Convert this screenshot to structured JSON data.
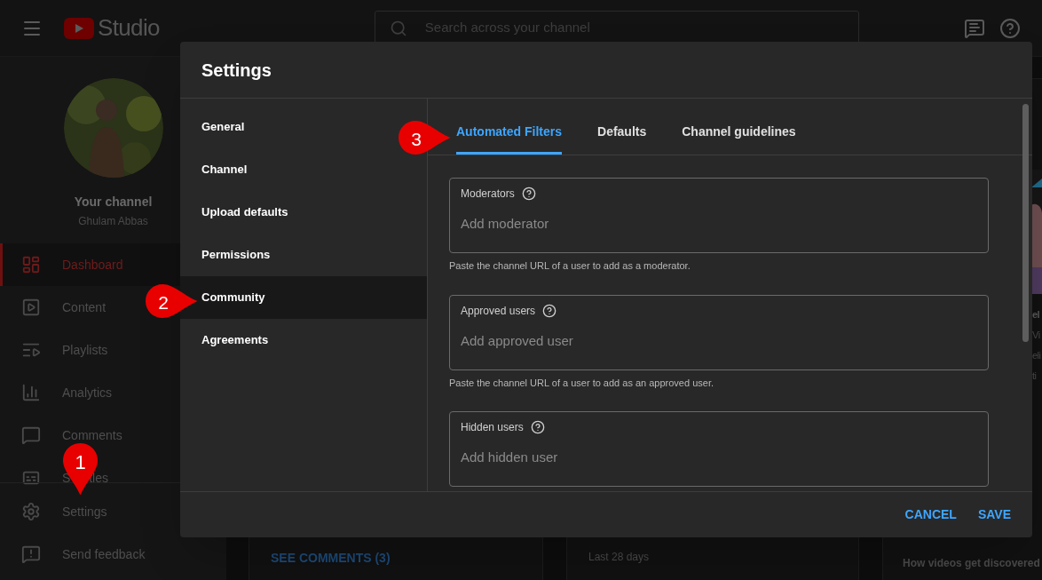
{
  "app": {
    "logo_text": "Studio",
    "search": {
      "placeholder": "Search across your channel"
    }
  },
  "sidebar": {
    "channel_label": "Your channel",
    "channel_name": "Ghulam Abbas",
    "items": [
      {
        "label": "Dashboard",
        "kind": "dashboard",
        "selected": true
      },
      {
        "label": "Content",
        "kind": "content",
        "selected": false
      },
      {
        "label": "Playlists",
        "kind": "playlists",
        "selected": false
      },
      {
        "label": "Analytics",
        "kind": "analytics",
        "selected": false
      },
      {
        "label": "Comments",
        "kind": "comments",
        "selected": false
      },
      {
        "label": "S",
        "label_end": "tles",
        "kind": "subtitles",
        "selected": false
      }
    ],
    "footer_items": [
      {
        "label": "Settings",
        "kind": "settings"
      },
      {
        "label": "Send feedback",
        "kind": "feedback"
      }
    ]
  },
  "background_cards": {
    "comments_link": "SEE COMMENTS (3)",
    "summary": {
      "subtitle": "Last 28 days"
    },
    "right_card": {
      "fragments": [
        "el",
        "Vi",
        "eli",
        "ti"
      ],
      "heading": "How videos get discovered"
    }
  },
  "dialog": {
    "title": "Settings",
    "nav": [
      {
        "label": "General",
        "selected": false
      },
      {
        "label": "Channel",
        "selected": false
      },
      {
        "label": "Upload defaults",
        "selected": false
      },
      {
        "label": "Permissions",
        "selected": false
      },
      {
        "label": "Community",
        "selected": true
      },
      {
        "label": "Agreements",
        "selected": false
      }
    ],
    "tabs": [
      {
        "label": "Automated Filters",
        "selected": true
      },
      {
        "label": "Defaults",
        "selected": false
      },
      {
        "label": "Channel guidelines",
        "selected": false
      }
    ],
    "fields": [
      {
        "label": "Moderators",
        "placeholder": "Add moderator",
        "hint": "Paste the channel URL of a user to add as a moderator."
      },
      {
        "label": "Approved users",
        "placeholder": "Add approved user",
        "hint": "Paste the channel URL of a user to add as an approved user."
      },
      {
        "label": "Hidden users",
        "placeholder": "Add hidden user"
      }
    ],
    "buttons": [
      "CANCEL",
      "SAVE"
    ]
  },
  "annotations": [
    {
      "number": "1"
    },
    {
      "number": "2"
    },
    {
      "number": "3"
    }
  ]
}
